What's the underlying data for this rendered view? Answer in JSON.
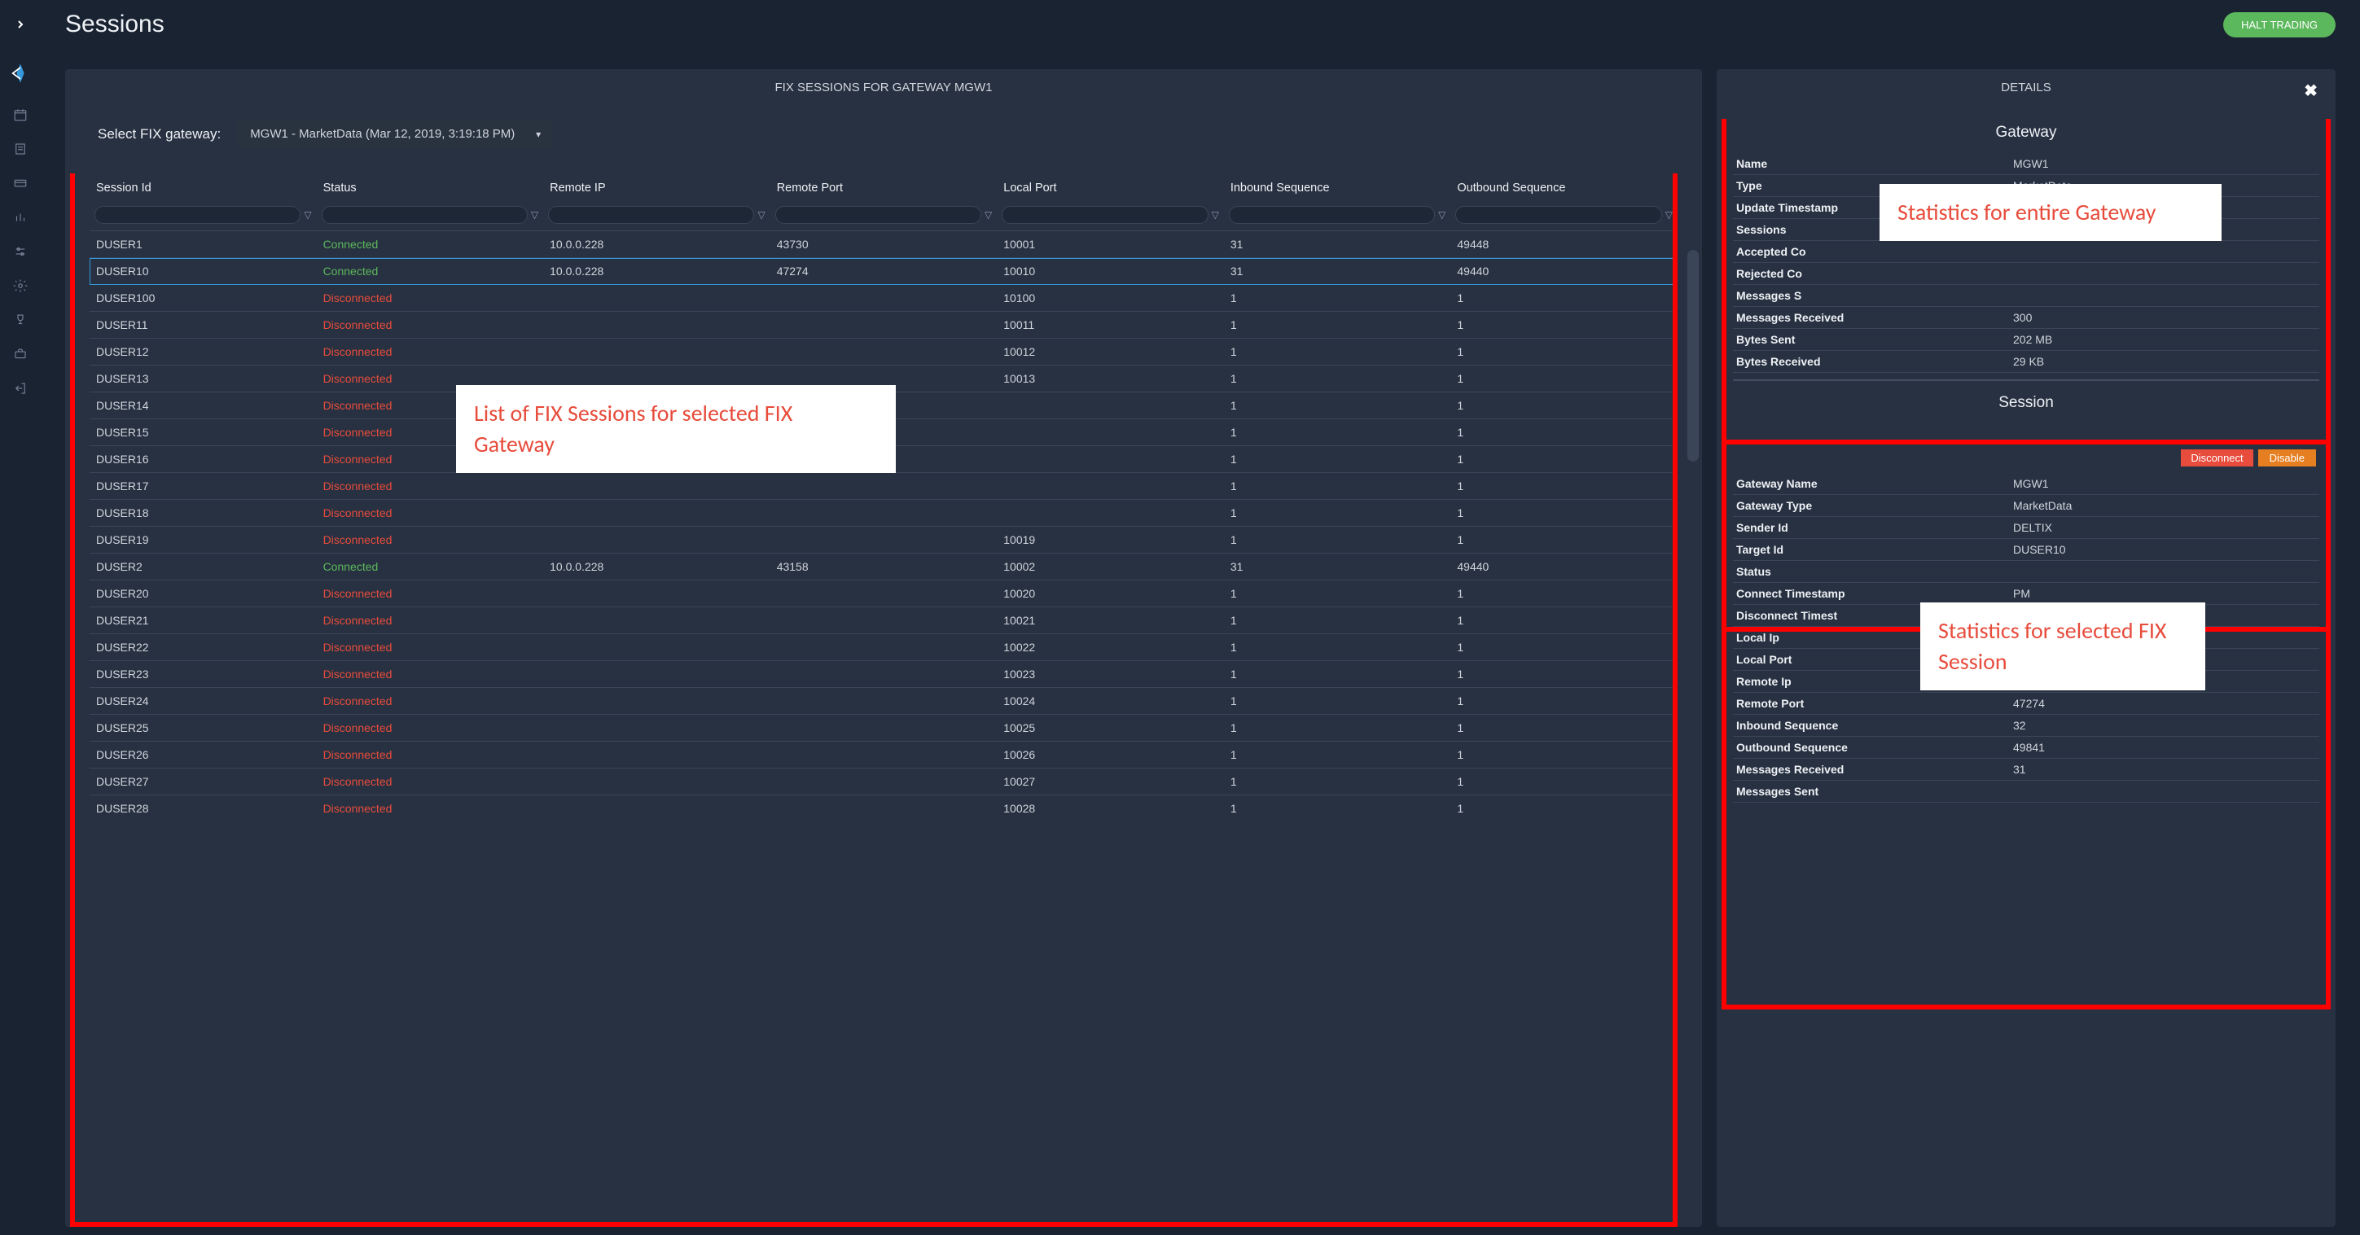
{
  "page_title": "Sessions",
  "halt_button": "HALT TRADING",
  "left_panel": {
    "title": "FIX SESSIONS FOR GATEWAY MGW1",
    "select_label": "Select FIX gateway:",
    "select_value": "MGW1 - MarketData (Mar 12, 2019, 3:19:18 PM)",
    "columns": [
      "Session Id",
      "Status",
      "Remote IP",
      "Remote Port",
      "Local Port",
      "Inbound Sequence",
      "Outbound Sequence"
    ],
    "rows": [
      {
        "id": "DUSER1",
        "status": "Connected",
        "rip": "10.0.0.228",
        "rport": "43730",
        "lport": "10001",
        "in": "31",
        "out": "49448",
        "sel": false
      },
      {
        "id": "DUSER10",
        "status": "Connected",
        "rip": "10.0.0.228",
        "rport": "47274",
        "lport": "10010",
        "in": "31",
        "out": "49440",
        "sel": true
      },
      {
        "id": "DUSER100",
        "status": "Disconnected",
        "rip": "",
        "rport": "",
        "lport": "10100",
        "in": "1",
        "out": "1",
        "sel": false
      },
      {
        "id": "DUSER11",
        "status": "Disconnected",
        "rip": "",
        "rport": "",
        "lport": "10011",
        "in": "1",
        "out": "1",
        "sel": false
      },
      {
        "id": "DUSER12",
        "status": "Disconnected",
        "rip": "",
        "rport": "",
        "lport": "10012",
        "in": "1",
        "out": "1",
        "sel": false
      },
      {
        "id": "DUSER13",
        "status": "Disconnected",
        "rip": "",
        "rport": "",
        "lport": "10013",
        "in": "1",
        "out": "1",
        "sel": false
      },
      {
        "id": "DUSER14",
        "status": "Disconnected",
        "rip": "",
        "rport": "",
        "lport": "",
        "in": "1",
        "out": "1",
        "sel": false
      },
      {
        "id": "DUSER15",
        "status": "Disconnected",
        "rip": "",
        "rport": "",
        "lport": "",
        "in": "1",
        "out": "1",
        "sel": false
      },
      {
        "id": "DUSER16",
        "status": "Disconnected",
        "rip": "",
        "rport": "",
        "lport": "",
        "in": "1",
        "out": "1",
        "sel": false
      },
      {
        "id": "DUSER17",
        "status": "Disconnected",
        "rip": "",
        "rport": "",
        "lport": "",
        "in": "1",
        "out": "1",
        "sel": false
      },
      {
        "id": "DUSER18",
        "status": "Disconnected",
        "rip": "",
        "rport": "",
        "lport": "",
        "in": "1",
        "out": "1",
        "sel": false
      },
      {
        "id": "DUSER19",
        "status": "Disconnected",
        "rip": "",
        "rport": "",
        "lport": "10019",
        "in": "1",
        "out": "1",
        "sel": false
      },
      {
        "id": "DUSER2",
        "status": "Connected",
        "rip": "10.0.0.228",
        "rport": "43158",
        "lport": "10002",
        "in": "31",
        "out": "49440",
        "sel": false
      },
      {
        "id": "DUSER20",
        "status": "Disconnected",
        "rip": "",
        "rport": "",
        "lport": "10020",
        "in": "1",
        "out": "1",
        "sel": false
      },
      {
        "id": "DUSER21",
        "status": "Disconnected",
        "rip": "",
        "rport": "",
        "lport": "10021",
        "in": "1",
        "out": "1",
        "sel": false
      },
      {
        "id": "DUSER22",
        "status": "Disconnected",
        "rip": "",
        "rport": "",
        "lport": "10022",
        "in": "1",
        "out": "1",
        "sel": false
      },
      {
        "id": "DUSER23",
        "status": "Disconnected",
        "rip": "",
        "rport": "",
        "lport": "10023",
        "in": "1",
        "out": "1",
        "sel": false
      },
      {
        "id": "DUSER24",
        "status": "Disconnected",
        "rip": "",
        "rport": "",
        "lport": "10024",
        "in": "1",
        "out": "1",
        "sel": false
      },
      {
        "id": "DUSER25",
        "status": "Disconnected",
        "rip": "",
        "rport": "",
        "lport": "10025",
        "in": "1",
        "out": "1",
        "sel": false
      },
      {
        "id": "DUSER26",
        "status": "Disconnected",
        "rip": "",
        "rport": "",
        "lport": "10026",
        "in": "1",
        "out": "1",
        "sel": false
      },
      {
        "id": "DUSER27",
        "status": "Disconnected",
        "rip": "",
        "rport": "",
        "lport": "10027",
        "in": "1",
        "out": "1",
        "sel": false
      },
      {
        "id": "DUSER28",
        "status": "Disconnected",
        "rip": "",
        "rport": "",
        "lport": "10028",
        "in": "1",
        "out": "1",
        "sel": false
      }
    ]
  },
  "right_panel": {
    "title": "DETAILS",
    "gateway_section": {
      "heading": "Gateway",
      "rows": [
        {
          "k": "Name",
          "v": "MGW1"
        },
        {
          "k": "Type",
          "v": "MarketData"
        },
        {
          "k": "Update Timestamp",
          "v": ""
        },
        {
          "k": "Sessions",
          "v": ""
        },
        {
          "k": "Accepted Co",
          "v": ""
        },
        {
          "k": "Rejected Co",
          "v": ""
        },
        {
          "k": "Messages S",
          "v": ""
        },
        {
          "k": "Messages Received",
          "v": "300"
        },
        {
          "k": "Bytes Sent",
          "v": "202 MB"
        },
        {
          "k": "Bytes Received",
          "v": "29 KB"
        }
      ],
      "next_heading": "Session"
    },
    "session_section": {
      "disconnect_label": "Disconnect",
      "disable_label": "Disable",
      "rows": [
        {
          "k": "Gateway Name",
          "v": "MGW1"
        },
        {
          "k": "Gateway Type",
          "v": "MarketData"
        },
        {
          "k": "Sender Id",
          "v": "DELTIX"
        },
        {
          "k": "Target Id",
          "v": "DUSER10"
        },
        {
          "k": "Status",
          "v": ""
        },
        {
          "k": "Connect Timestamp",
          "v": "PM"
        },
        {
          "k": "Disconnect Timest",
          "v": ""
        },
        {
          "k": "Local Ip",
          "v": ""
        },
        {
          "k": "Local Port",
          "v": ""
        },
        {
          "k": "Remote Ip",
          "v": ""
        },
        {
          "k": "Remote Port",
          "v": "47274"
        },
        {
          "k": "Inbound Sequence",
          "v": "32"
        },
        {
          "k": "Outbound Sequence",
          "v": "49841"
        },
        {
          "k": "Messages Received",
          "v": "31"
        },
        {
          "k": "Messages Sent",
          "v": ""
        }
      ]
    }
  },
  "annotations": {
    "list": "List of FIX Sessions for selected FIX Gateway",
    "gateway": "Statistics for entire Gateway",
    "session": "Statistics for selected FIX Session"
  }
}
